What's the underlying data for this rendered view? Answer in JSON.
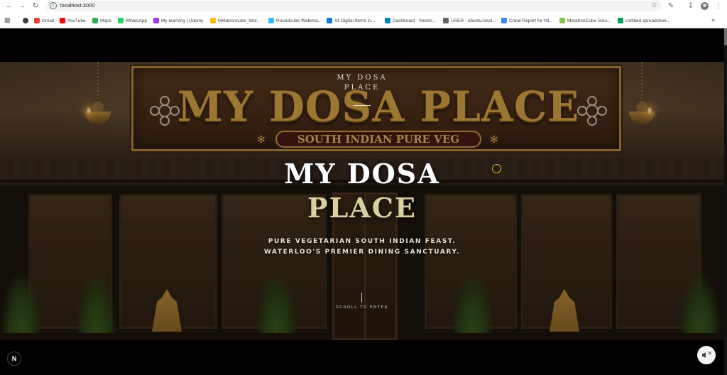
{
  "browser": {
    "url": "localhost:3000",
    "nav_icons": [
      "back-arrow-icon",
      "forward-arrow-icon",
      "reload-icon"
    ],
    "bookmarks": [
      {
        "label": "Gmail",
        "color": "#ea4335"
      },
      {
        "label": "YouTube",
        "color": "#ff0000"
      },
      {
        "label": "Maps",
        "color": "#34a853"
      },
      {
        "label": "WhatsApp",
        "color": "#25d366"
      },
      {
        "label": "My learning | Udemy",
        "color": "#a435f0"
      },
      {
        "label": "Metatroncube_Wor...",
        "color": "#fbbc04"
      },
      {
        "label": "Roundcube Webmai...",
        "color": "#37beff"
      },
      {
        "label": "All Digital Items in...",
        "color": "#1a73e8"
      },
      {
        "label": "Dashboard - Nextcl...",
        "color": "#0082c9"
      },
      {
        "label": "USER - ubuntu-best...",
        "color": "#5f6368"
      },
      {
        "label": "Crawl Report for htt...",
        "color": "#4285f4"
      },
      {
        "label": "MetatronCube Solu...",
        "color": "#8bc34a"
      },
      {
        "label": "Untitled spreadshee...",
        "color": "#0f9d58"
      }
    ]
  },
  "hero": {
    "sign_title": "MY DOSA PLACE",
    "sign_banner": "SOUTH INDIAN PURE VEG",
    "logo_line1": "MY DOSA",
    "logo_line2": "PLACE",
    "title_line1": "MY DOSA",
    "title_line2": "PLACE",
    "tagline_line1": "PURE VEGETARIAN SOUTH INDIAN FEAST.",
    "tagline_line2": "WATERLOO'S PREMIER DINING SANCTUARY.",
    "scroll_hint": "SCROLL TO ENTER"
  },
  "overlay": {
    "next_badge": "N",
    "mute_icon": "speaker-muted-icon"
  },
  "colors": {
    "accent_gold": "#d9a544",
    "title_cream": "#d9cfa0"
  }
}
